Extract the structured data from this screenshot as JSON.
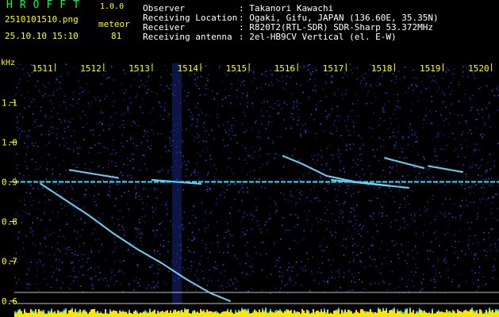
{
  "header": {
    "app_title": "HROFFT",
    "version": "1.0.0",
    "filename": "2510101510.png",
    "datetime": "25.10.10 15:10",
    "meteor_label": "meteor",
    "meteor_count": "81",
    "info": [
      {
        "label": "Observer",
        "value": ": Takanori Kawachi"
      },
      {
        "label": "Receiving Location",
        "value": ": Ogaki, Gifu, JAPAN (136.60E, 35.35N)"
      },
      {
        "label": "Receiver",
        "value": ": R820T2(RTL-SDR) SDR-Sharp 53.372MHz"
      },
      {
        "label": "Receiving antenna",
        "value": ": 2el-HB9CV Vertical (el. E-W)"
      }
    ]
  },
  "colors": {
    "label_yellow": "#ffff00",
    "label_green": "#00ff3c",
    "background": "#000000",
    "noise_blue": "#1a2a8a",
    "carrier": "#33ddff",
    "level_yellow": "#ffe600",
    "level_cyan": "#00ccff"
  },
  "chart_data": {
    "type": "heatmap",
    "title": "",
    "ylabel": "kHz",
    "x_ticks": [
      "1511",
      "1512",
      "1513",
      "1514",
      "1515",
      "1516",
      "1517",
      "1518",
      "1519",
      "1520"
    ],
    "y_ticks": [
      "1.1",
      "1.0",
      "0.9",
      "0.8",
      "0.7",
      "0.6"
    ],
    "ylim": [
      0.58,
      1.19
    ],
    "xlim": [
      1510.7,
      1520.25
    ],
    "carrier_khz": 0.9,
    "echoes": [
      {
        "name": "long-echo-1",
        "x": [
          1510.7,
          1511.2,
          1511.7,
          1512.2,
          1512.7,
          1513.2,
          1513.7,
          1514.2,
          1514.6
        ],
        "y": [
          0.895,
          0.855,
          0.815,
          0.77,
          0.73,
          0.695,
          0.655,
          0.62,
          0.6
        ]
      },
      {
        "name": "echo-2",
        "x": [
          1511.3,
          1512.3
        ],
        "y": [
          0.93,
          0.91
        ]
      },
      {
        "name": "echo-3",
        "x": [
          1513.0,
          1514.0
        ],
        "y": [
          0.905,
          0.895
        ]
      },
      {
        "name": "echo-4",
        "x": [
          1515.7,
          1516.1,
          1516.6,
          1517.2,
          1517.9
        ],
        "y": [
          0.965,
          0.945,
          0.915,
          0.9,
          0.89
        ]
      },
      {
        "name": "echo-5",
        "x": [
          1516.7,
          1518.3
        ],
        "y": [
          0.905,
          0.885
        ]
      },
      {
        "name": "echo-6",
        "x": [
          1517.8,
          1518.6
        ],
        "y": [
          0.96,
          0.935
        ]
      },
      {
        "name": "echo-7",
        "x": [
          1518.7,
          1519.4
        ],
        "y": [
          0.94,
          0.925
        ]
      }
    ]
  }
}
